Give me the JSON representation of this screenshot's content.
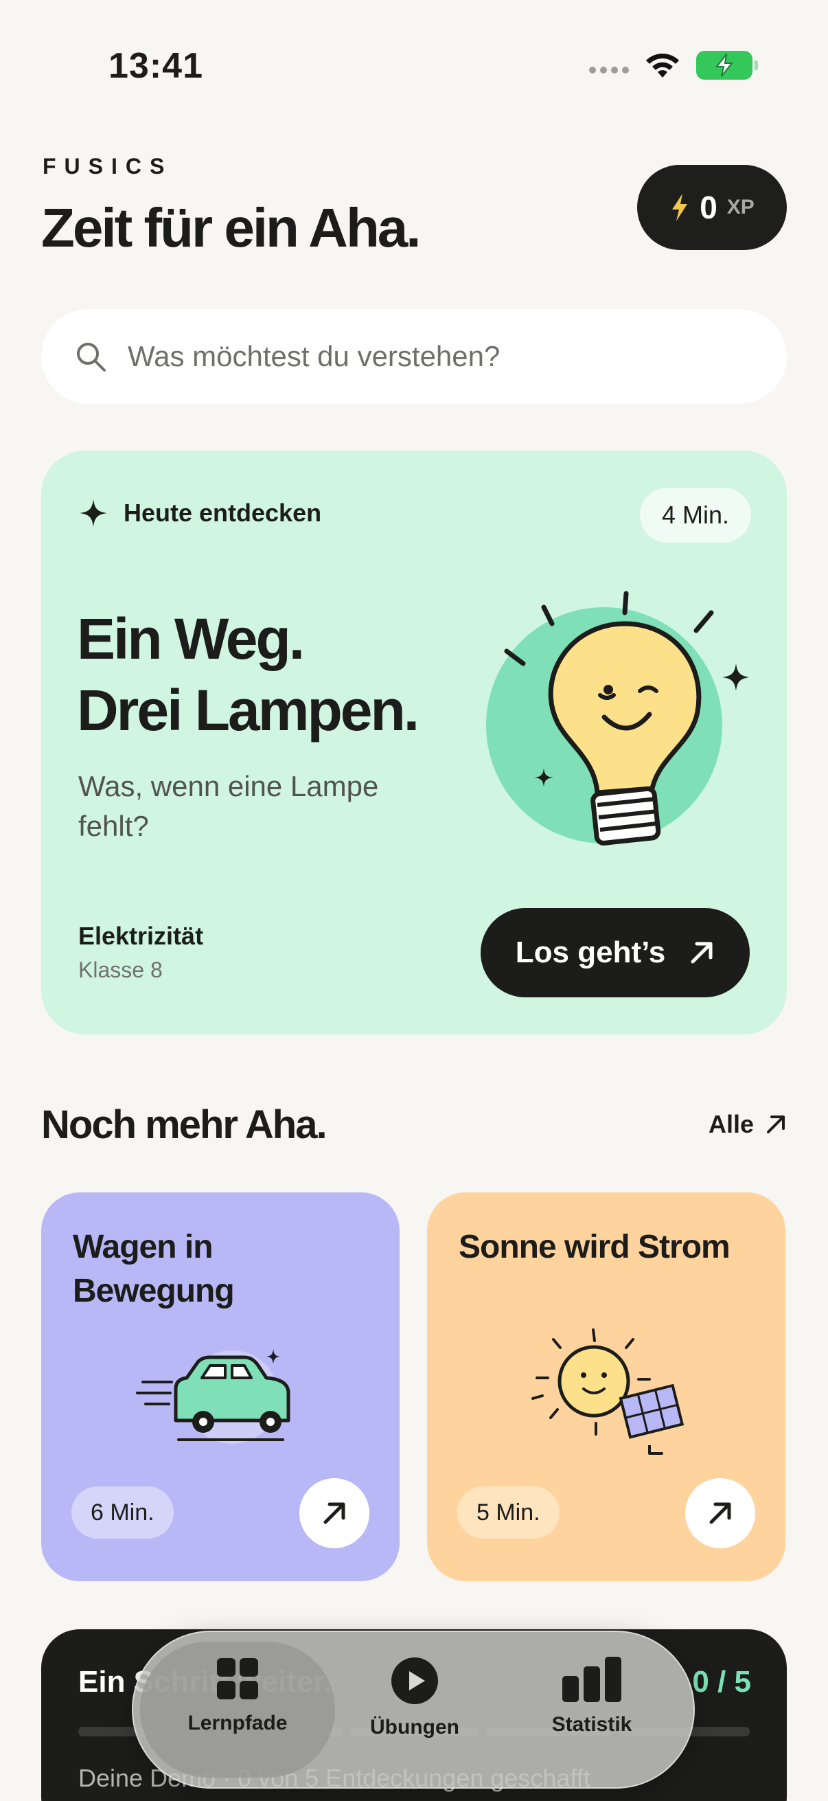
{
  "status_bar": {
    "time": "13:41"
  },
  "header": {
    "brand": "FUSICS",
    "headline": "Zeit für ein Aha.",
    "xp_value": "0",
    "xp_unit": "XP"
  },
  "search": {
    "placeholder": "Was möchtest du verstehen?"
  },
  "featured": {
    "tag": "Heute entdecken",
    "duration": "4 Min.",
    "title_line1": "Ein Weg.",
    "title_line2": "Drei Lampen.",
    "subtitle": "Was, wenn eine Lampe fehlt?",
    "topic": "Elektrizität",
    "grade": "Klasse 8",
    "cta_label": "Los geht’s",
    "colors": {
      "card": "#D0F5E1",
      "illustration": "#7FE0B7",
      "bulb": "#FDE08A"
    }
  },
  "more": {
    "title": "Noch mehr Aha.",
    "see_all_label": "Alle",
    "lessons": [
      {
        "title": "Wagen in Bewegung",
        "duration": "6 Min.",
        "color": "#B8B8F7",
        "icon": "car-icon"
      },
      {
        "title": "Sonne wird Strom",
        "duration": "5 Min.",
        "color": "#FFD39D",
        "icon": "sun-solar-icon"
      }
    ]
  },
  "progress": {
    "title": "Ein Schritt weiter.",
    "count": "0 / 5",
    "caption": "Deine Demo · 0 von 5 Entdeckungen geschafft",
    "completed": 0,
    "total": 5
  },
  "tabbar": {
    "tabs": [
      {
        "label": "Lernpfade",
        "icon": "grid-icon",
        "active": true
      },
      {
        "label": "Übungen",
        "icon": "play-icon",
        "active": false
      },
      {
        "label": "Statistik",
        "icon": "bar-chart-icon",
        "active": false
      }
    ]
  }
}
